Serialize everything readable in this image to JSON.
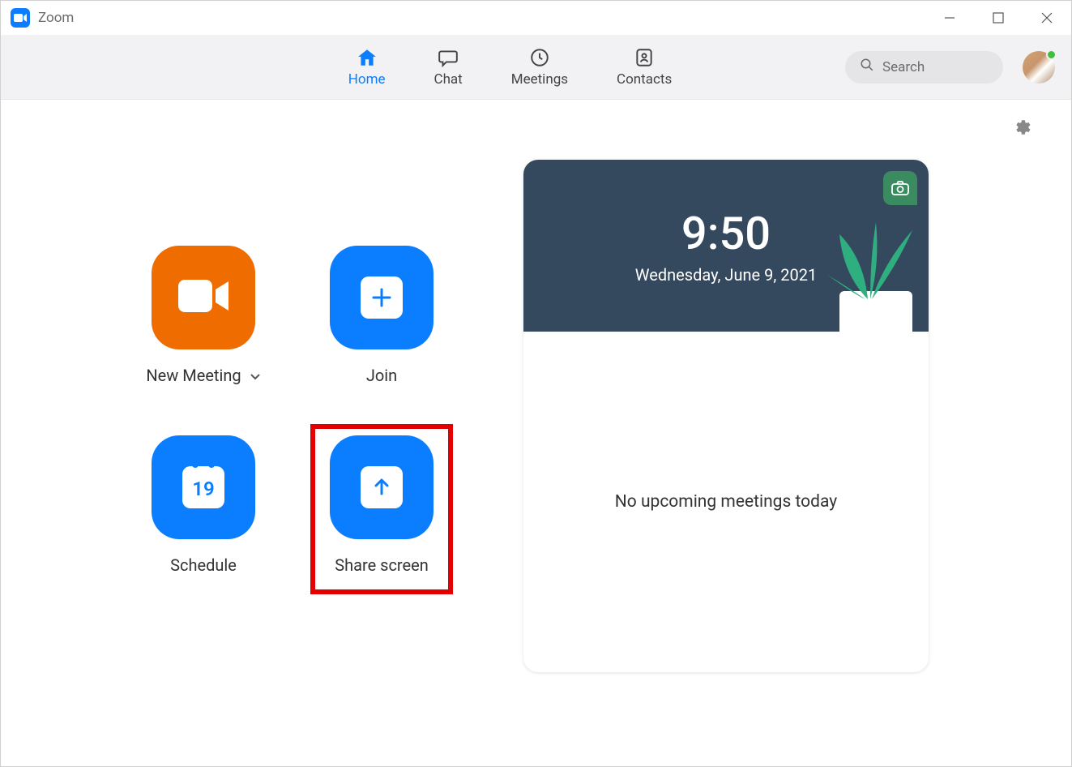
{
  "window": {
    "title": "Zoom"
  },
  "nav": {
    "tabs": [
      {
        "id": "home",
        "label": "Home",
        "active": true
      },
      {
        "id": "chat",
        "label": "Chat",
        "active": false
      },
      {
        "id": "meetings",
        "label": "Meetings",
        "active": false
      },
      {
        "id": "contacts",
        "label": "Contacts",
        "active": false
      }
    ]
  },
  "search": {
    "placeholder": "Search"
  },
  "actions": {
    "new_meeting": "New Meeting",
    "join": "Join",
    "schedule": "Schedule",
    "schedule_day": "19",
    "share_screen": "Share screen"
  },
  "hero": {
    "time": "9:50",
    "date": "Wednesday, June 9, 2021"
  },
  "meetings": {
    "empty_text": "No upcoming meetings today"
  },
  "colors": {
    "accent": "#0b7eff",
    "orange": "#ef6c00",
    "highlight": "#e20000"
  },
  "annotation": {
    "highlighted": "share_screen"
  }
}
